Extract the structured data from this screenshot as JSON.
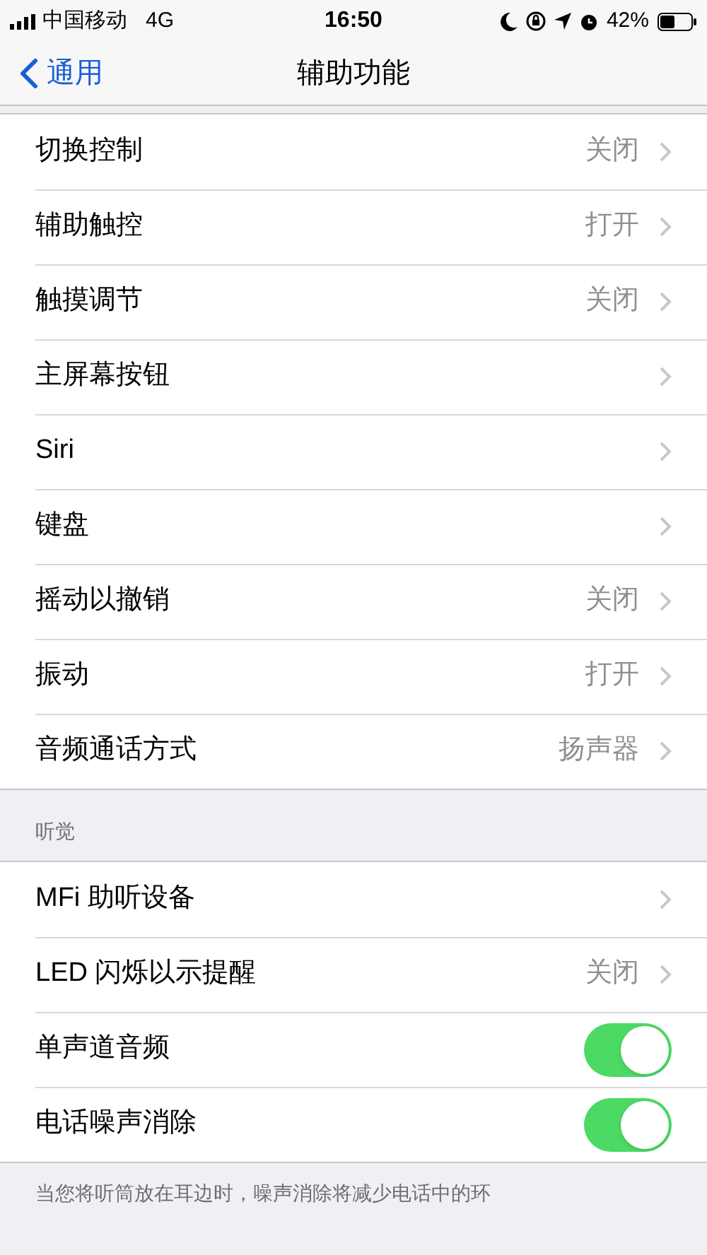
{
  "status_bar": {
    "carrier": "中国移动",
    "network": "4G",
    "time": "16:50",
    "battery": "42%"
  },
  "nav": {
    "back": "通用",
    "title": "辅助功能"
  },
  "groups": [
    {
      "rows": [
        {
          "kind": "detail",
          "label": "切换控制",
          "value": "关闭"
        },
        {
          "kind": "detail",
          "label": "辅助触控",
          "value": "打开"
        },
        {
          "kind": "detail",
          "label": "触摸调节",
          "value": "关闭"
        },
        {
          "kind": "detail",
          "label": "主屏幕按钮"
        },
        {
          "kind": "detail",
          "label": "Siri"
        },
        {
          "kind": "detail",
          "label": "键盘"
        },
        {
          "kind": "detail",
          "label": "摇动以撤销",
          "value": "关闭"
        },
        {
          "kind": "detail",
          "label": "振动",
          "value": "打开"
        },
        {
          "kind": "detail",
          "label": "音频通话方式",
          "value": "扬声器"
        }
      ]
    },
    {
      "header": "听觉",
      "rows": [
        {
          "kind": "detail",
          "label": "MFi 助听设备"
        },
        {
          "kind": "detail",
          "label": "LED 闪烁以示提醒",
          "value": "关闭"
        },
        {
          "kind": "toggle",
          "label": "单声道音频",
          "on": true
        },
        {
          "kind": "toggle",
          "label": "电话噪声消除",
          "on": true
        }
      ],
      "footer": "当您将听筒放在耳边时，噪声消除将减少电话中的环"
    }
  ]
}
